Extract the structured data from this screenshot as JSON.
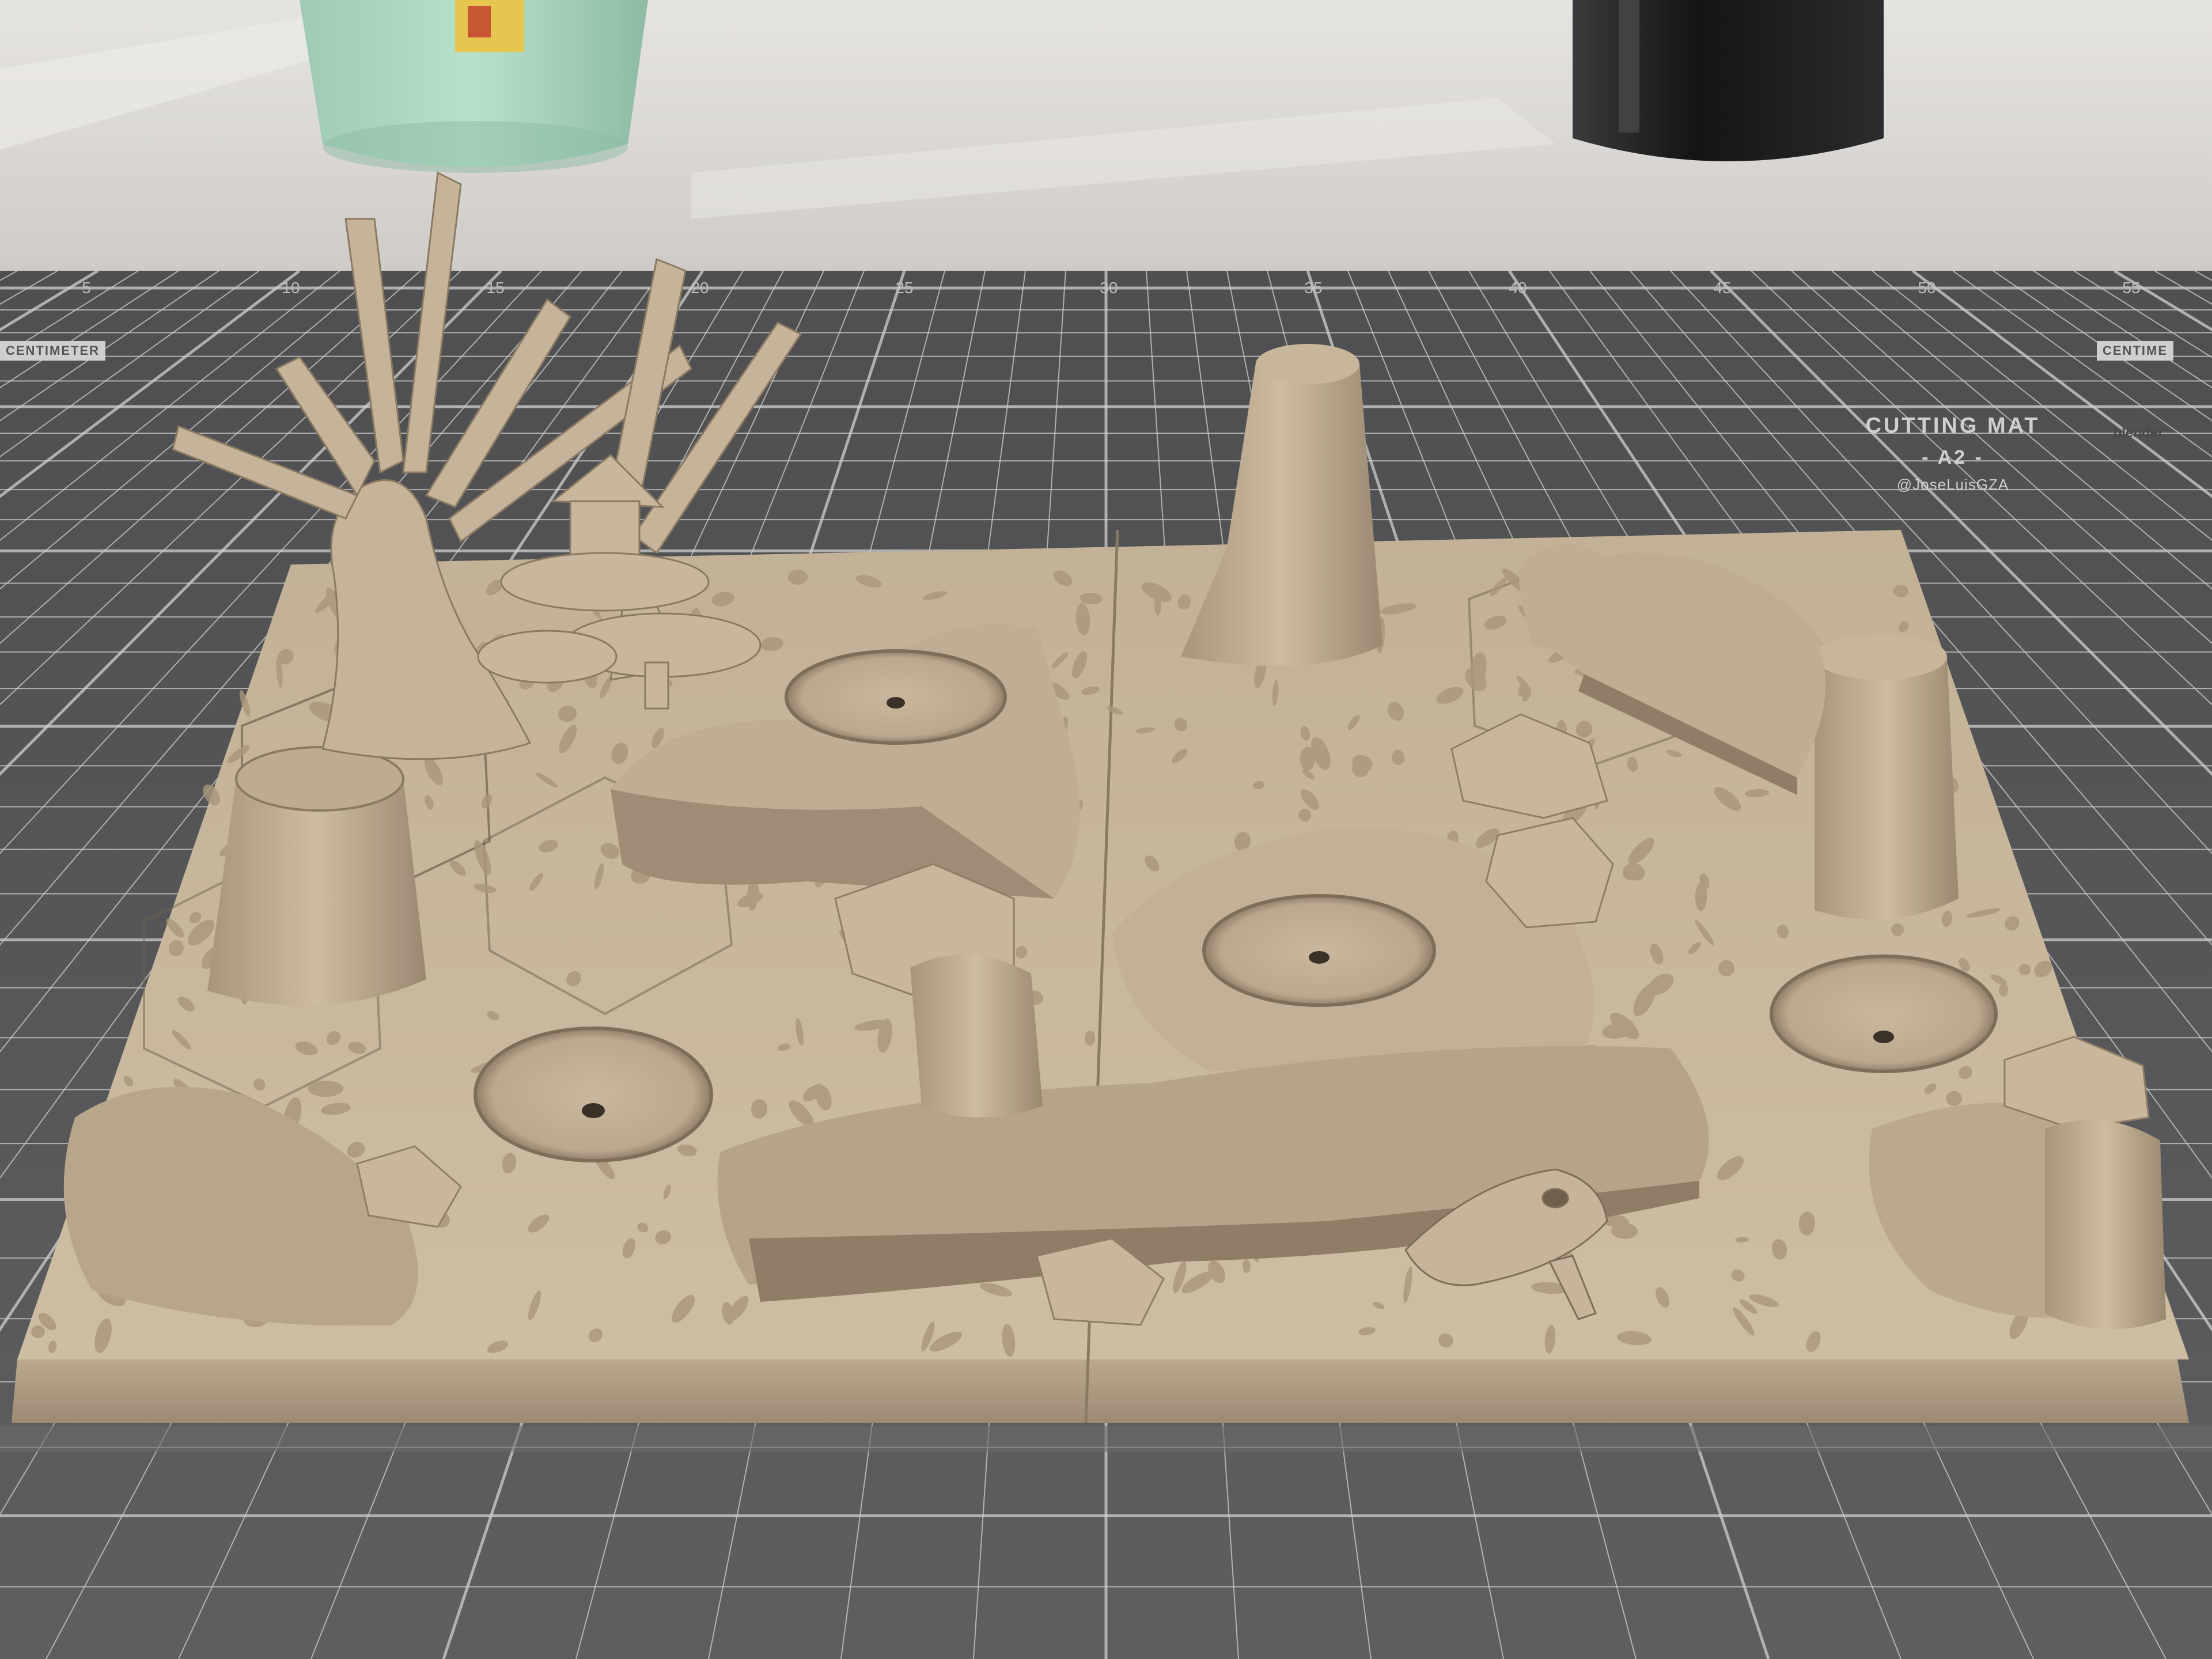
{
  "image": {
    "subject": "3D rendered tabletop terrain board on a cutting mat",
    "colors": {
      "wall": "#dcd9d5",
      "mat": "#5b5b5d",
      "grid": "#d9d9d9",
      "terrain": "#cbb9a0",
      "terrain_shadow": "#8c7a62",
      "cup": "#a9d3bd",
      "jar": "#1e1e1f"
    }
  },
  "mat": {
    "title": "CUTTING MAT",
    "size": "- A2 -",
    "handle": "@JoseLuisGZA",
    "logo_text": "blender",
    "left_tag": "CENTIMETER",
    "right_tag": "CENTIME",
    "ruler_numbers": [
      "5",
      "10",
      "15",
      "20",
      "25",
      "30",
      "35",
      "40",
      "45",
      "50",
      "55"
    ]
  }
}
